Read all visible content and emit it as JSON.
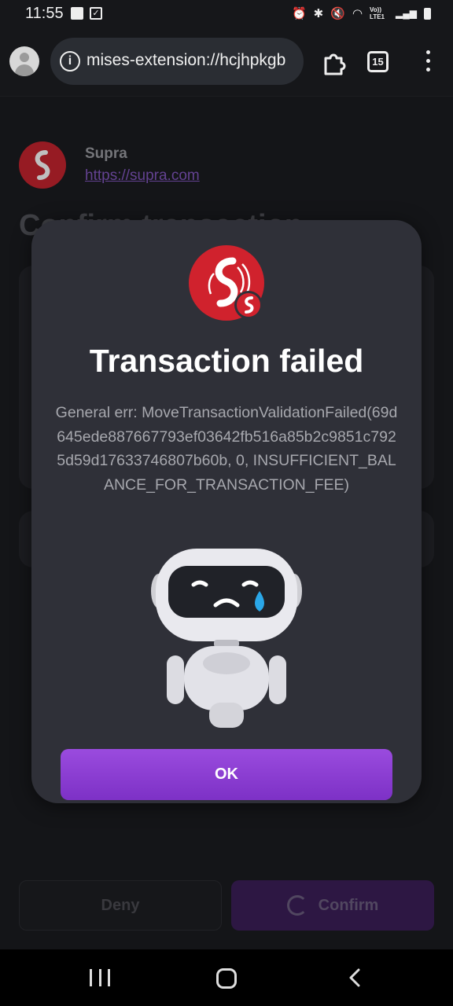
{
  "status_bar": {
    "time": "11:55",
    "signal_text": "Vo)) LTE1"
  },
  "browser": {
    "url": "mises-extension://hcjhpkgb",
    "tab_count": "15"
  },
  "site": {
    "name": "Supra",
    "url": "https://supra.com",
    "brand_color": "#c8242f"
  },
  "page": {
    "heading_partial": "Confirm transaction",
    "deny_label": "Deny",
    "confirm_label": "Confirm"
  },
  "modal": {
    "title": "Transaction failed",
    "message": "General err: MoveTransactionValidationFailed(69d645ede887667793ef03642fb516a85b2c9851c7925d59d17633746807b60b, 0, INSUFFICIENT_BALANCE_FOR_TRANSACTION_FEE)",
    "ok_label": "OK",
    "accent_color": "#8a3fd4"
  },
  "icons": {
    "status": [
      "image-icon",
      "checkbox-icon",
      "alarm-icon",
      "bluetooth-icon",
      "mute-icon",
      "wifi-icon",
      "signal-icon",
      "battery-icon"
    ],
    "toolbar": [
      "info-icon",
      "extensions-icon",
      "tabs-icon",
      "more-menu-icon"
    ],
    "nav": [
      "recent-apps-icon",
      "home-icon",
      "back-icon"
    ]
  }
}
